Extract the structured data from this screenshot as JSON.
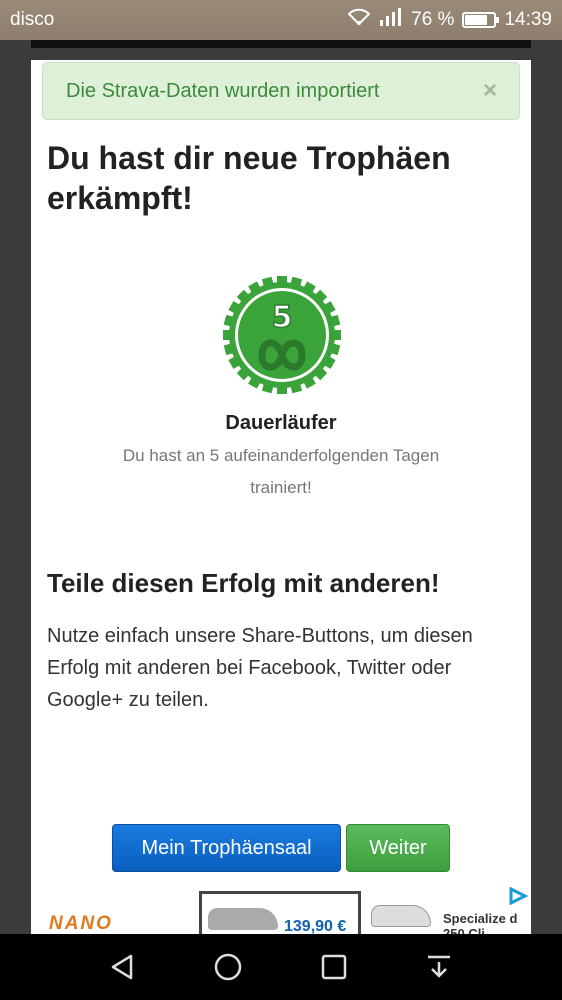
{
  "status_bar": {
    "app_name": "disco",
    "battery_percent": "76 %",
    "battery_level": 0.76,
    "time": "14:39"
  },
  "alert": {
    "message": "Die Strava-Daten wurden importiert",
    "close_label": "×"
  },
  "page": {
    "title": "Du hast dir neue Trophäen erkämpft!"
  },
  "trophy": {
    "badge_number": "5",
    "name": "Dauerläufer",
    "description": "Du hast an 5 aufeinanderfolgenden Tagen trainiert!",
    "badge_color": "#3aa33a",
    "badge_icon": "infinity-icon"
  },
  "share": {
    "title": "Teile diesen Erfolg mit anderen!",
    "text": "Nutze einfach unsere Share-Buttons, um diesen Erfolg mit anderen bei Facebook, Twitter oder Google+ zu teilen."
  },
  "buttons": {
    "trophy_hall": "Mein Trophäensaal",
    "next": "Weiter"
  },
  "ad": {
    "brand": "NANO",
    "price": "139,90 €",
    "product_text": "Specialize d 250 Cli"
  },
  "colors": {
    "alert_bg": "#dff0d8",
    "alert_text": "#3c8b3c",
    "primary_button": "#0a5fbf",
    "success_button": "#3e9e3e"
  }
}
